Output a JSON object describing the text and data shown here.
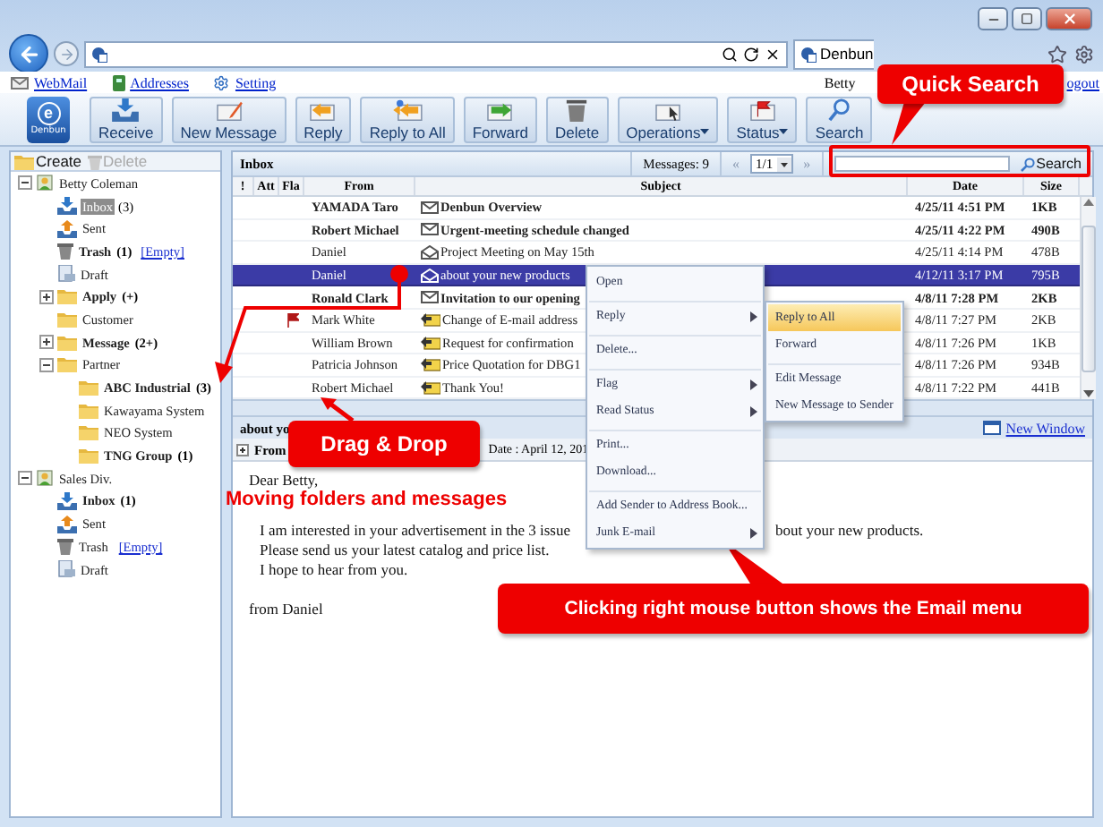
{
  "browser": {
    "tab_title": "Denbun"
  },
  "links": [
    {
      "label": "WebMail",
      "kind": "mail"
    },
    {
      "label": "Addresses",
      "kind": "book"
    },
    {
      "label": "Setting",
      "kind": "gear"
    }
  ],
  "user": {
    "name": "Betty",
    "logout": "ogout"
  },
  "logo": {
    "mark": "e",
    "name": "Denbun"
  },
  "toolbar": [
    {
      "label": "Receive",
      "kind": "receive",
      "dropdown": false
    },
    {
      "label": "New Message",
      "kind": "compose",
      "dropdown": false
    },
    {
      "label": "Reply",
      "kind": "reply",
      "dropdown": false
    },
    {
      "label": "Reply to All",
      "kind": "replyall",
      "dropdown": false
    },
    {
      "label": "Forward",
      "kind": "forward",
      "dropdown": false
    },
    {
      "label": "Delete",
      "kind": "delete",
      "dropdown": false
    },
    {
      "label": "Operations",
      "kind": "operations",
      "dropdown": true
    },
    {
      "label": "Status",
      "kind": "status",
      "dropdown": true
    },
    {
      "label": "Search",
      "kind": "search",
      "dropdown": false
    }
  ],
  "folder_panel": {
    "create": "Create",
    "delete": "Delete",
    "delete_disabled": true
  },
  "folders": [
    {
      "label": "Betty Coleman",
      "kind": "account",
      "expanded": true,
      "selected": false,
      "unread": false,
      "children": [
        {
          "label": "Inbox",
          "count": "(3)",
          "kind": "inbox",
          "selected": true,
          "unread": false
        },
        {
          "label": "Sent",
          "kind": "sent",
          "selected": false,
          "unread": false
        },
        {
          "label": "Trash",
          "count": "(1)",
          "action": "[Empty]",
          "kind": "trash",
          "selected": false,
          "unread": true
        },
        {
          "label": "Draft",
          "kind": "draft",
          "selected": false,
          "unread": false
        },
        {
          "label": "Apply",
          "count": "(+)",
          "kind": "folder",
          "expanded": false,
          "selected": false,
          "unread": true
        },
        {
          "label": "Customer",
          "kind": "folder",
          "selected": false,
          "unread": false
        },
        {
          "label": "Message",
          "count": "(2+)",
          "kind": "folder",
          "expanded": false,
          "selected": false,
          "unread": true
        },
        {
          "label": "Partner",
          "kind": "folder",
          "expanded": true,
          "selected": false,
          "unread": false,
          "children": [
            {
              "label": "ABC Industrial",
              "count": "(3)",
              "kind": "folder",
              "selected": false,
              "unread": true
            },
            {
              "label": "Kawayama System",
              "kind": "folder",
              "selected": false,
              "unread": false
            },
            {
              "label": "NEO System",
              "kind": "folder",
              "selected": false,
              "unread": false
            },
            {
              "label": "TNG Group",
              "count": "(1)",
              "kind": "folder",
              "selected": false,
              "unread": true
            }
          ]
        }
      ]
    },
    {
      "label": "Sales Div.",
      "kind": "account",
      "expanded": true,
      "selected": false,
      "unread": false,
      "children": [
        {
          "label": "Inbox",
          "count": "(1)",
          "kind": "inbox",
          "selected": false,
          "unread": true
        },
        {
          "label": "Sent",
          "kind": "sent",
          "selected": false,
          "unread": false
        },
        {
          "label": "Trash",
          "action": "[Empty]",
          "kind": "trash",
          "selected": false,
          "unread": false
        },
        {
          "label": "Draft",
          "kind": "draft",
          "selected": false,
          "unread": false
        }
      ]
    }
  ],
  "list": {
    "title": "Inbox",
    "count": "Messages: 9",
    "prev": "«",
    "page": "1/1",
    "next": "»",
    "search_button": "Search"
  },
  "columns": [
    "!",
    "Att",
    "Fla",
    "From",
    "Subject",
    "Date",
    "Size"
  ],
  "messages": [
    {
      "from": "YAMADA Taro",
      "subject": "Denbun Overview",
      "date": "4/25/11 4:51 PM",
      "size": "1KB",
      "unread": true,
      "selected": false,
      "flagged": false,
      "kind": "unread"
    },
    {
      "from": "Robert Michael",
      "subject": "Urgent-meeting schedule changed",
      "date": "4/25/11 4:22 PM",
      "size": "490B",
      "unread": true,
      "selected": false,
      "flagged": false,
      "kind": "unread"
    },
    {
      "from": "Daniel",
      "subject": "Project Meeting on May 15th",
      "date": "4/25/11 4:14 PM",
      "size": "478B",
      "unread": false,
      "selected": false,
      "flagged": false,
      "kind": "read"
    },
    {
      "from": "Daniel",
      "subject": "about your new products",
      "date": "4/12/11 3:17 PM",
      "size": "795B",
      "unread": false,
      "selected": true,
      "flagged": false,
      "kind": "read"
    },
    {
      "from": "Ronald Clark",
      "subject": "Invitation to our opening",
      "date": "4/8/11 7:28 PM",
      "size": "2KB",
      "unread": true,
      "selected": false,
      "flagged": false,
      "kind": "unread"
    },
    {
      "from": "Mark White",
      "subject": "Change of E-mail address",
      "date": "4/8/11 7:27 PM",
      "size": "2KB",
      "unread": false,
      "selected": false,
      "flagged": true,
      "kind": "replied"
    },
    {
      "from": "William Brown",
      "subject": "Request for confirmation",
      "date": "4/8/11 7:26 PM",
      "size": "1KB",
      "unread": false,
      "selected": false,
      "flagged": false,
      "kind": "replied"
    },
    {
      "from": "Patricia Johnson",
      "subject": "Price Quotation for DBG1",
      "date": "4/8/11 7:26 PM",
      "size": "934B",
      "unread": false,
      "selected": false,
      "flagged": false,
      "kind": "replied"
    },
    {
      "from": "Robert Michael",
      "subject": "Thank You!",
      "date": "4/8/11 7:22 PM",
      "size": "441B",
      "unread": false,
      "selected": false,
      "flagged": false,
      "kind": "replied"
    }
  ],
  "preview": {
    "subject": "about yo",
    "from_label": "From",
    "date": "Date : April 12, 201",
    "new_window": "New Window",
    "greeting": "Dear Betty,",
    "lines": [
      {
        "text": "I am interested in your advertisement in the 3 issue",
        "after_menu": "bout your new products."
      },
      {
        "text": "Please send us your latest catalog and price list."
      },
      {
        "text": "I hope to hear from you."
      }
    ],
    "signature": "from Daniel"
  },
  "context_menu": {
    "items": [
      {
        "label": "Open",
        "submenu": false,
        "separator_before": false
      },
      {
        "label": "Reply",
        "submenu": true,
        "separator_before": true
      },
      {
        "label": "Delete...",
        "submenu": false,
        "separator_before": true
      },
      {
        "label": "Flag",
        "submenu": true,
        "separator_before": true
      },
      {
        "label": "Read Status",
        "submenu": true,
        "separator_before": false
      },
      {
        "label": "Print...",
        "submenu": false,
        "separator_before": true
      },
      {
        "label": "Download...",
        "submenu": false,
        "separator_before": false
      },
      {
        "label": "Add Sender to Address Book...",
        "submenu": false,
        "separator_before": true
      },
      {
        "label": "Junk E-mail",
        "submenu": true,
        "separator_before": false
      }
    ],
    "submenu": [
      {
        "label": "Reply to All",
        "selected": true,
        "separator_before": false
      },
      {
        "label": "Forward",
        "selected": false,
        "separator_before": false
      },
      {
        "label": "Edit Message",
        "selected": false,
        "separator_before": true
      },
      {
        "label": "New Message to Sender",
        "selected": false,
        "separator_before": false
      }
    ]
  },
  "callouts": [
    {
      "kind": "quick-search",
      "text": "Quick Search"
    },
    {
      "kind": "drag-drop",
      "text": "Drag & Drop"
    },
    {
      "kind": "right-click",
      "text": "Clicking right mouse button shows the Email menu"
    }
  ],
  "annotation": "Moving folders and messages"
}
